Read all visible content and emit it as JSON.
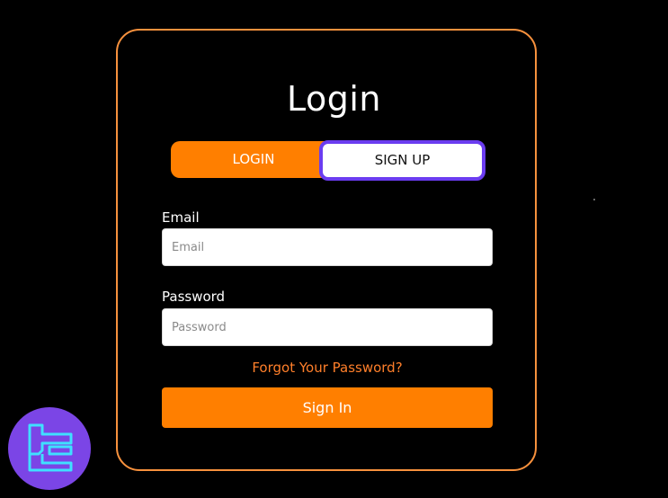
{
  "heading": "Login",
  "tabs": {
    "login_label": "LOGIN",
    "signup_label": "SIGN UP"
  },
  "form": {
    "email_label": "Email",
    "email_placeholder": "Email",
    "password_label": "Password",
    "password_placeholder": "Password",
    "forgot_link": "Forgot Your Password?",
    "submit_label": "Sign In"
  },
  "brand": {
    "logo_icon": "tc-logo-icon",
    "accent_color": "#ff7f00",
    "border_color": "#f7913d",
    "focus_color": "#6b3cf0",
    "logo_bg": "#7b45e6",
    "logo_stroke": "#3fe0ff"
  }
}
